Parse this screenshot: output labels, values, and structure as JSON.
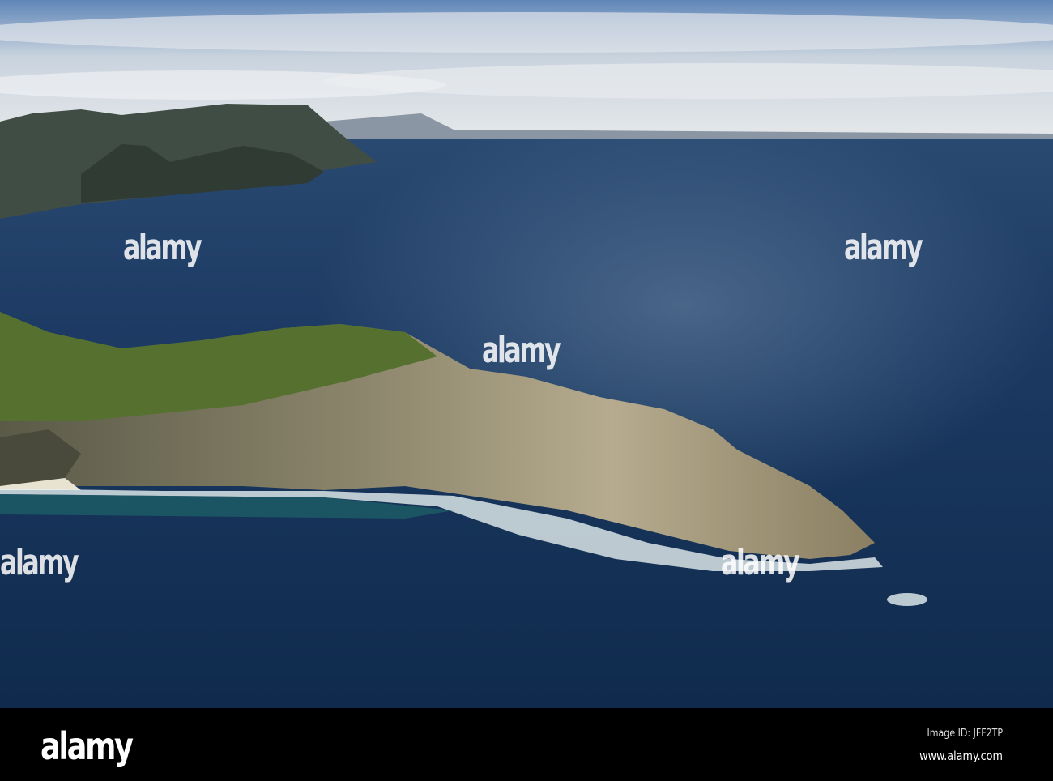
{
  "watermark": {
    "text": "alamy"
  },
  "footer": {
    "logo": "alamy",
    "image_id": "Image ID: JFF2TP",
    "url": "www.alamy.com"
  },
  "colors": {
    "sky": "#8fa9c8",
    "ocean": "#17345a",
    "land": "#6b7a3c",
    "cliff": "#a89c7c",
    "surf": "#e6f0f0"
  }
}
